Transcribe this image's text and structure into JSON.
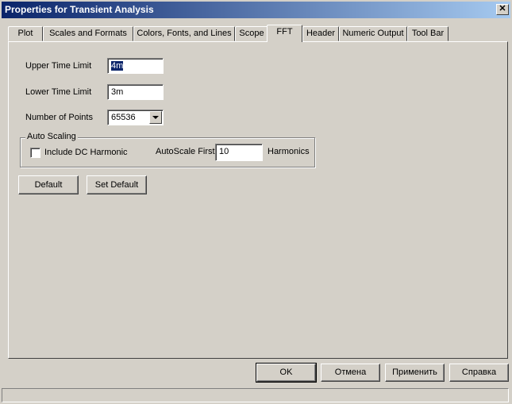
{
  "window": {
    "title": "Properties for Transient Analysis",
    "close_glyph": "✕"
  },
  "tabs": [
    {
      "label": "Plot"
    },
    {
      "label": "Scales and Formats"
    },
    {
      "label": "Colors, Fonts, and Lines"
    },
    {
      "label": "Scope"
    },
    {
      "label": "FFT",
      "active": true
    },
    {
      "label": "Header"
    },
    {
      "label": "Numeric Output"
    },
    {
      "label": "Tool Bar"
    }
  ],
  "fft": {
    "upper_time_limit_label": "Upper Time Limit",
    "upper_time_limit_value": "4m",
    "lower_time_limit_label": "Lower Time Limit",
    "lower_time_limit_value": "3m",
    "number_of_points_label": "Number of Points",
    "number_of_points_value": "65536",
    "auto_scaling": {
      "legend": "Auto Scaling",
      "include_dc_label": "Include DC Harmonic",
      "include_dc_checked": false,
      "autoscale_first_label": "AutoScale First",
      "autoscale_first_value": "10",
      "harmonics_label": "Harmonics"
    },
    "default_button": "Default",
    "set_default_button": "Set Default"
  },
  "footer": {
    "ok": "OK",
    "cancel": "Отмена",
    "apply": "Применить",
    "help": "Справка"
  }
}
